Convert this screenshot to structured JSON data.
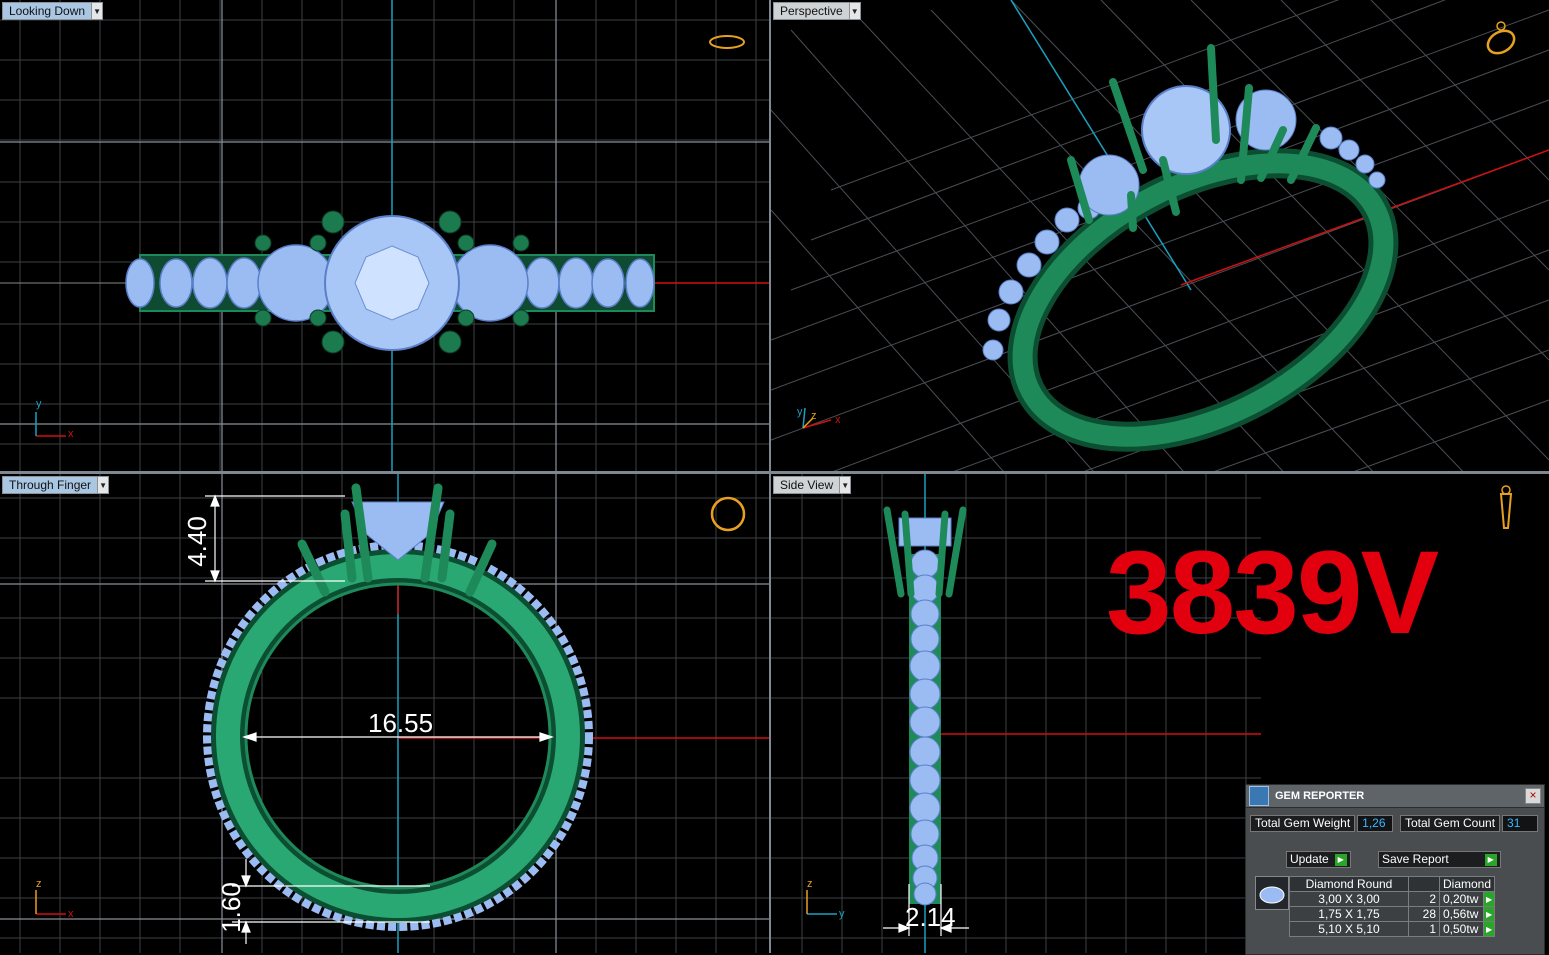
{
  "viewports": {
    "top": {
      "label": "Looking Down",
      "axis_x": "x",
      "axis_y": "y"
    },
    "perspective": {
      "label": "Perspective",
      "axis_x": "x",
      "axis_y": "y",
      "axis_z": "z"
    },
    "front": {
      "label": "Through Finger",
      "axis_x": "x",
      "axis_y": "z"
    },
    "side": {
      "label": "Side View",
      "axis_x": "y",
      "axis_y": "z"
    }
  },
  "dimensions": {
    "head_height": "4.40",
    "inner_diameter": "16.55",
    "shank_thickness": "1.60",
    "shank_width": "2.14"
  },
  "model_code": "3839V",
  "gem_reporter": {
    "title": "GEM REPORTER",
    "close_label": "×",
    "total_weight_label": "Total Gem Weight",
    "total_weight_value": "1,26",
    "total_count_label": "Total Gem Count",
    "total_count_value": "31",
    "update_label": "Update",
    "save_label": "Save Report",
    "table": {
      "headers": [
        "Diamond Round",
        "",
        "Diamond"
      ],
      "rows": [
        {
          "size": "3,00 X 3,00",
          "count": "2",
          "weight": "0,20tw"
        },
        {
          "size": "1,75 X 1,75",
          "count": "28",
          "weight": "0,56tw"
        },
        {
          "size": "5,10 X 5,10",
          "count": "1",
          "weight": "0,50tw"
        }
      ]
    }
  },
  "colors": {
    "metal": "#1e8a5a",
    "gem": "#9bbcf2",
    "axis_x": "#d01010",
    "axis_y": "#1aa0c0",
    "sku": "#e3000e"
  }
}
